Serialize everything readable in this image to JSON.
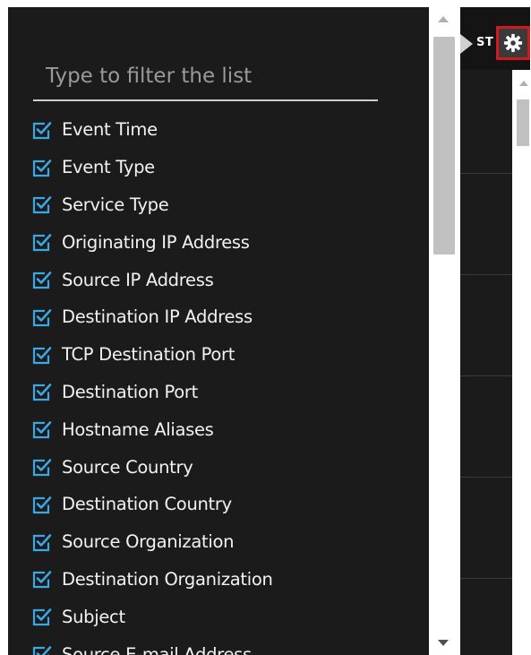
{
  "filter": {
    "placeholder": "Type to filter the list",
    "value": ""
  },
  "columns": [
    {
      "label": "Event Time",
      "checked": true
    },
    {
      "label": "Event Type",
      "checked": true
    },
    {
      "label": "Service Type",
      "checked": true
    },
    {
      "label": "Originating IP Address",
      "checked": true
    },
    {
      "label": "Source IP Address",
      "checked": true
    },
    {
      "label": "Destination IP Address",
      "checked": true
    },
    {
      "label": "TCP Destination Port",
      "checked": true
    },
    {
      "label": "Destination Port",
      "checked": true
    },
    {
      "label": "Hostname Aliases",
      "checked": true
    },
    {
      "label": "Source Country",
      "checked": true
    },
    {
      "label": "Destination Country",
      "checked": true
    },
    {
      "label": "Source Organization",
      "checked": true
    },
    {
      "label": "Destination Organization",
      "checked": true
    },
    {
      "label": "Subject",
      "checked": true
    },
    {
      "label": "Source E-mail Address",
      "checked": true
    }
  ],
  "table_header": {
    "partial_label": "ST"
  },
  "icons": {
    "checkbox": "checkbox-checked-icon",
    "settings": "gear-icon"
  },
  "colors": {
    "accent": "#3aa7e6",
    "highlight_border": "#d11a1a",
    "panel_bg": "#1b1b1b"
  }
}
